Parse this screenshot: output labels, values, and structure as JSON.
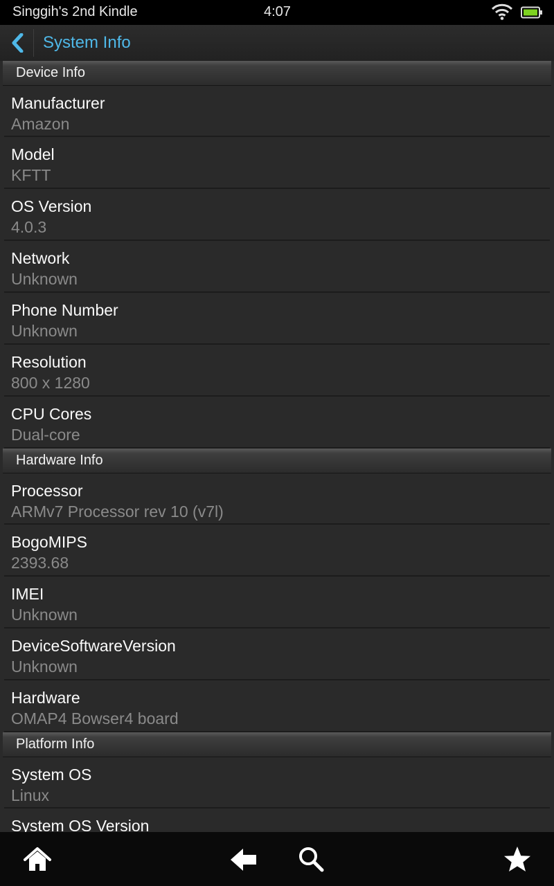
{
  "status_bar": {
    "device_name": "Singgih's 2nd Kindle",
    "time": "4:07",
    "icons": [
      "wifi-icon",
      "battery-icon"
    ]
  },
  "action_bar": {
    "title": "System Info",
    "back_icon": "chevron-left-icon",
    "accent_color": "#4fb8e8"
  },
  "sections": [
    {
      "title": "Device Info",
      "items": [
        {
          "label": "Manufacturer",
          "value": "Amazon"
        },
        {
          "label": "Model",
          "value": "KFTT"
        },
        {
          "label": "OS Version",
          "value": "4.0.3"
        },
        {
          "label": "Network",
          "value": "Unknown"
        },
        {
          "label": "Phone Number",
          "value": "Unknown"
        },
        {
          "label": "Resolution",
          "value": "800 x 1280"
        },
        {
          "label": "CPU Cores",
          "value": "Dual-core"
        }
      ]
    },
    {
      "title": "Hardware Info",
      "items": [
        {
          "label": "Processor",
          "value": "ARMv7 Processor rev 10 (v7l)"
        },
        {
          "label": "BogoMIPS",
          "value": "2393.68"
        },
        {
          "label": "IMEI",
          "value": "Unknown"
        },
        {
          "label": "DeviceSoftwareVersion",
          "value": "Unknown"
        },
        {
          "label": "Hardware",
          "value": "OMAP4 Bowser4 board"
        }
      ]
    },
    {
      "title": "Platform Info",
      "items": [
        {
          "label": "System OS",
          "value": "Linux"
        },
        {
          "label": "System OS Version",
          "value": ""
        }
      ]
    }
  ],
  "nav_bar": {
    "icons": [
      "home-icon",
      "back-arrow-icon",
      "search-icon",
      "favorites-star-icon"
    ]
  }
}
